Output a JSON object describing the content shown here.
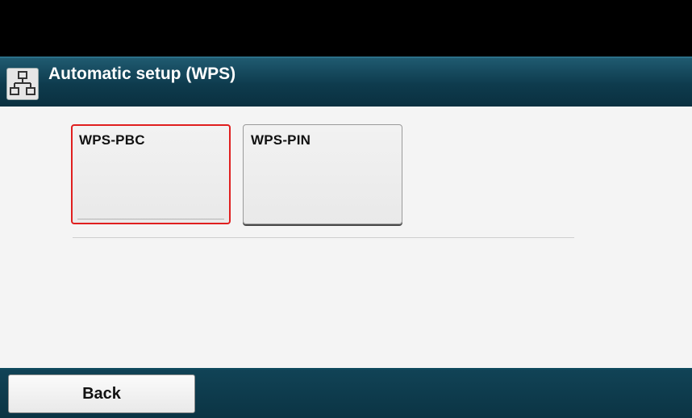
{
  "header": {
    "title": "Automatic setup (WPS)",
    "icon": "network-icon",
    "color": "#0e3b4d"
  },
  "options": [
    {
      "label": "WPS-PBC",
      "selected": true
    },
    {
      "label": "WPS-PIN",
      "selected": false
    }
  ],
  "footer": {
    "back_label": "Back"
  },
  "colors": {
    "selection_border": "#e01f1f",
    "content_background": "#f4f4f4"
  }
}
